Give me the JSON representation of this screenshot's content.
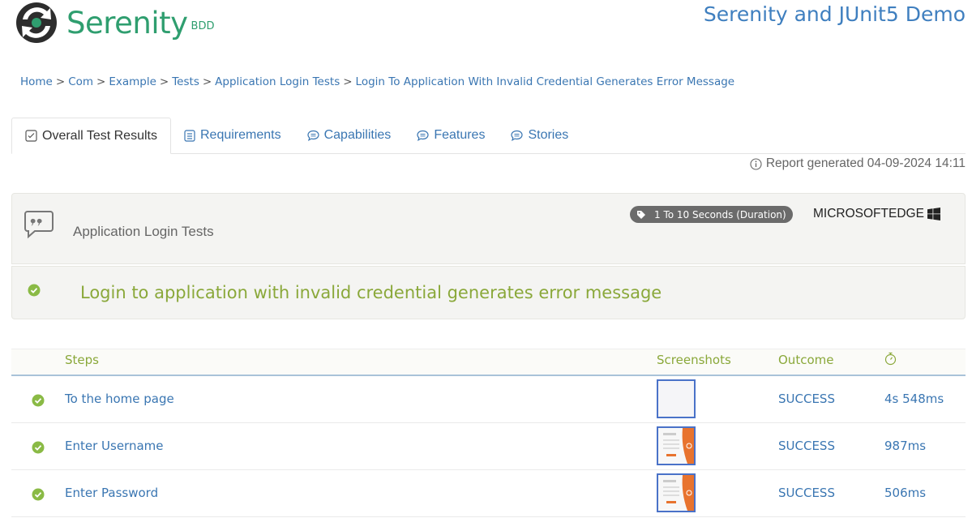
{
  "header": {
    "logo_text": "Serenity",
    "logo_suffix": "BDD",
    "project_title": "Serenity and JUnit5 Demo"
  },
  "breadcrumb": {
    "items": [
      "Home",
      "Com",
      "Example",
      "Tests",
      "Application Login Tests",
      "Login To Application With Invalid Credential Generates Error Message"
    ],
    "separator": ">"
  },
  "tabs": [
    {
      "label": "Overall Test Results",
      "icon": "checklist-icon",
      "active": true
    },
    {
      "label": "Requirements",
      "icon": "list-icon",
      "active": false
    },
    {
      "label": "Capabilities",
      "icon": "speech-bubble-icon",
      "active": false
    },
    {
      "label": "Features",
      "icon": "speech-bubble-icon",
      "active": false
    },
    {
      "label": "Stories",
      "icon": "speech-bubble-icon",
      "active": false
    }
  ],
  "report_generated": "Report generated 04-09-2024 14:11",
  "story": {
    "title": "Application Login Tests",
    "tag": "1 To 10 Seconds (Duration)",
    "platform": "MICROSOFTEDGE"
  },
  "scenario": {
    "title": "Login to application with invalid credential generates error message",
    "status": "success"
  },
  "steps_table": {
    "headers": {
      "steps": "Steps",
      "screenshots": "Screenshots",
      "outcome": "Outcome"
    },
    "rows": [
      {
        "description": "To the home page",
        "outcome": "SUCCESS",
        "duration": "4s 548ms",
        "screenshot": "blank"
      },
      {
        "description": "Enter Username",
        "outcome": "SUCCESS",
        "duration": "987ms",
        "screenshot": "login-form"
      },
      {
        "description": "Enter Password",
        "outcome": "SUCCESS",
        "duration": "506ms",
        "screenshot": "login-form"
      }
    ]
  },
  "colors": {
    "brand_green": "#2f9e6f",
    "title_blue": "#3f7fbf",
    "link_blue": "#3a76b2",
    "success_green": "#8aa83a",
    "tag_gray": "#6b6b6b"
  }
}
